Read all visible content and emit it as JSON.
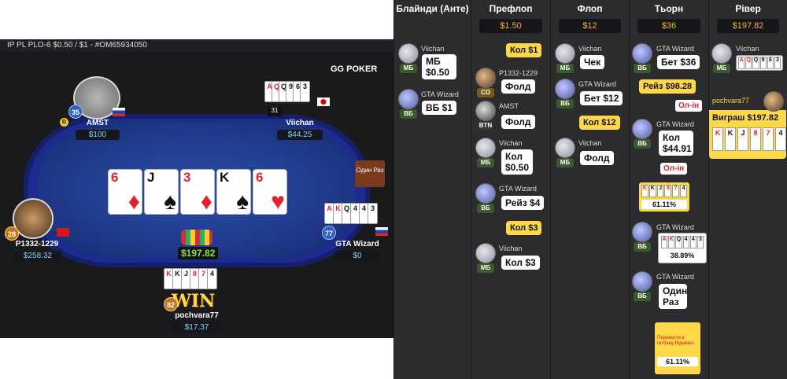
{
  "table": {
    "header": "IP PL PLO-6 $0.50 / $1  - #OM65934050",
    "logo": "GG POKER",
    "pot": "$197.82",
    "win_label": "WIN",
    "run_once_label": "Один Раз",
    "board": [
      {
        "rank": "6",
        "suit": "♦",
        "color": "red"
      },
      {
        "rank": "J",
        "suit": "♠",
        "color": "blk"
      },
      {
        "rank": "3",
        "suit": "♦",
        "color": "red"
      },
      {
        "rank": "K",
        "suit": "♠",
        "color": "blk"
      },
      {
        "rank": "6",
        "suit": "♥",
        "color": "red"
      }
    ],
    "players": {
      "amst": {
        "name": "AMST",
        "stack": "$100",
        "level": "35",
        "dealer": "D"
      },
      "viichan": {
        "name": "Viichan",
        "stack": "$44.25",
        "level": "31",
        "cards": "AQQ963"
      },
      "p1332": {
        "name": "P1332-1229",
        "stack": "$258.32",
        "level": "28"
      },
      "gta": {
        "name": "GTA Wizard",
        "stack": "$0",
        "level": "77",
        "cards": "AKQ443"
      },
      "pochvara": {
        "name": "pochvara77",
        "stack": "$17.37",
        "level": "82",
        "cards": "KKJ874"
      }
    }
  },
  "history": {
    "columns": [
      {
        "title": "Блайнди (Анте)",
        "pot": ""
      },
      {
        "title": "Префлоп",
        "pot": "$1.50"
      },
      {
        "title": "Флоп",
        "pot": "$12"
      },
      {
        "title": "Тьорн",
        "pot": "$36"
      },
      {
        "title": "Рівер",
        "pot": "$197.82"
      }
    ],
    "blinds": [
      {
        "name": "Viichan",
        "pos": "МБ",
        "action": "МБ $0.50"
      },
      {
        "name": "GTA Wizard",
        "pos": "ВБ",
        "action": "ВБ $1"
      }
    ],
    "preflop": [
      {
        "type": "y",
        "text": "Кол $1"
      },
      {
        "name": "P1332-1229",
        "pos": "CO",
        "action": "Фолд"
      },
      {
        "name": "AMST",
        "pos": "BTN",
        "action": "Фолд"
      },
      {
        "name": "Viichan",
        "pos": "МБ",
        "action": "Кол $0.50"
      },
      {
        "name": "GTA Wizard",
        "pos": "ВБ",
        "action": "Рейз $4"
      },
      {
        "type": "y",
        "text": "Кол $3"
      },
      {
        "name": "Viichan",
        "pos": "МБ",
        "action": "Кол $3"
      }
    ],
    "flop": [
      {
        "name": "Viichan",
        "pos": "МБ",
        "action": "Чек"
      },
      {
        "name": "GTA Wizard",
        "pos": "ВБ",
        "action": "Бет $12"
      },
      {
        "type": "y",
        "text": "Кол $12"
      },
      {
        "name": "Viichan",
        "pos": "МБ",
        "action": "Фолд"
      }
    ],
    "turn": [
      {
        "name": "GTA Wizard",
        "pos": "ВБ",
        "action": "Бет $36"
      },
      {
        "type": "y",
        "text": "Рейз $98.28"
      },
      {
        "type": "allin",
        "text": "Ол-ін"
      },
      {
        "name": "GTA Wizard",
        "pos": "ВБ",
        "action": "Кол $44.91"
      },
      {
        "type": "allin",
        "text": "Ол-ін"
      },
      {
        "type": "eq",
        "cards": "KKJ874",
        "pct": "61.11%"
      },
      {
        "name": "GTA Wizard",
        "pos": "ВБ",
        "cards": "AKQ443",
        "pct": "38.89%"
      },
      {
        "name": "GTA Wizard",
        "pos": "ВБ",
        "action": "Один Раз"
      },
      {
        "type": "note",
        "text": "Перевести в гатбану Віднімно",
        "pct": "61.11%"
      }
    ],
    "river": {
      "viichan": {
        "name": "Viichan",
        "pos": "МБ",
        "cards": "AQQ963"
      },
      "winner": {
        "name": "pochvara77",
        "text": "Виграш $197.82",
        "cards": "KKJ874"
      }
    }
  }
}
